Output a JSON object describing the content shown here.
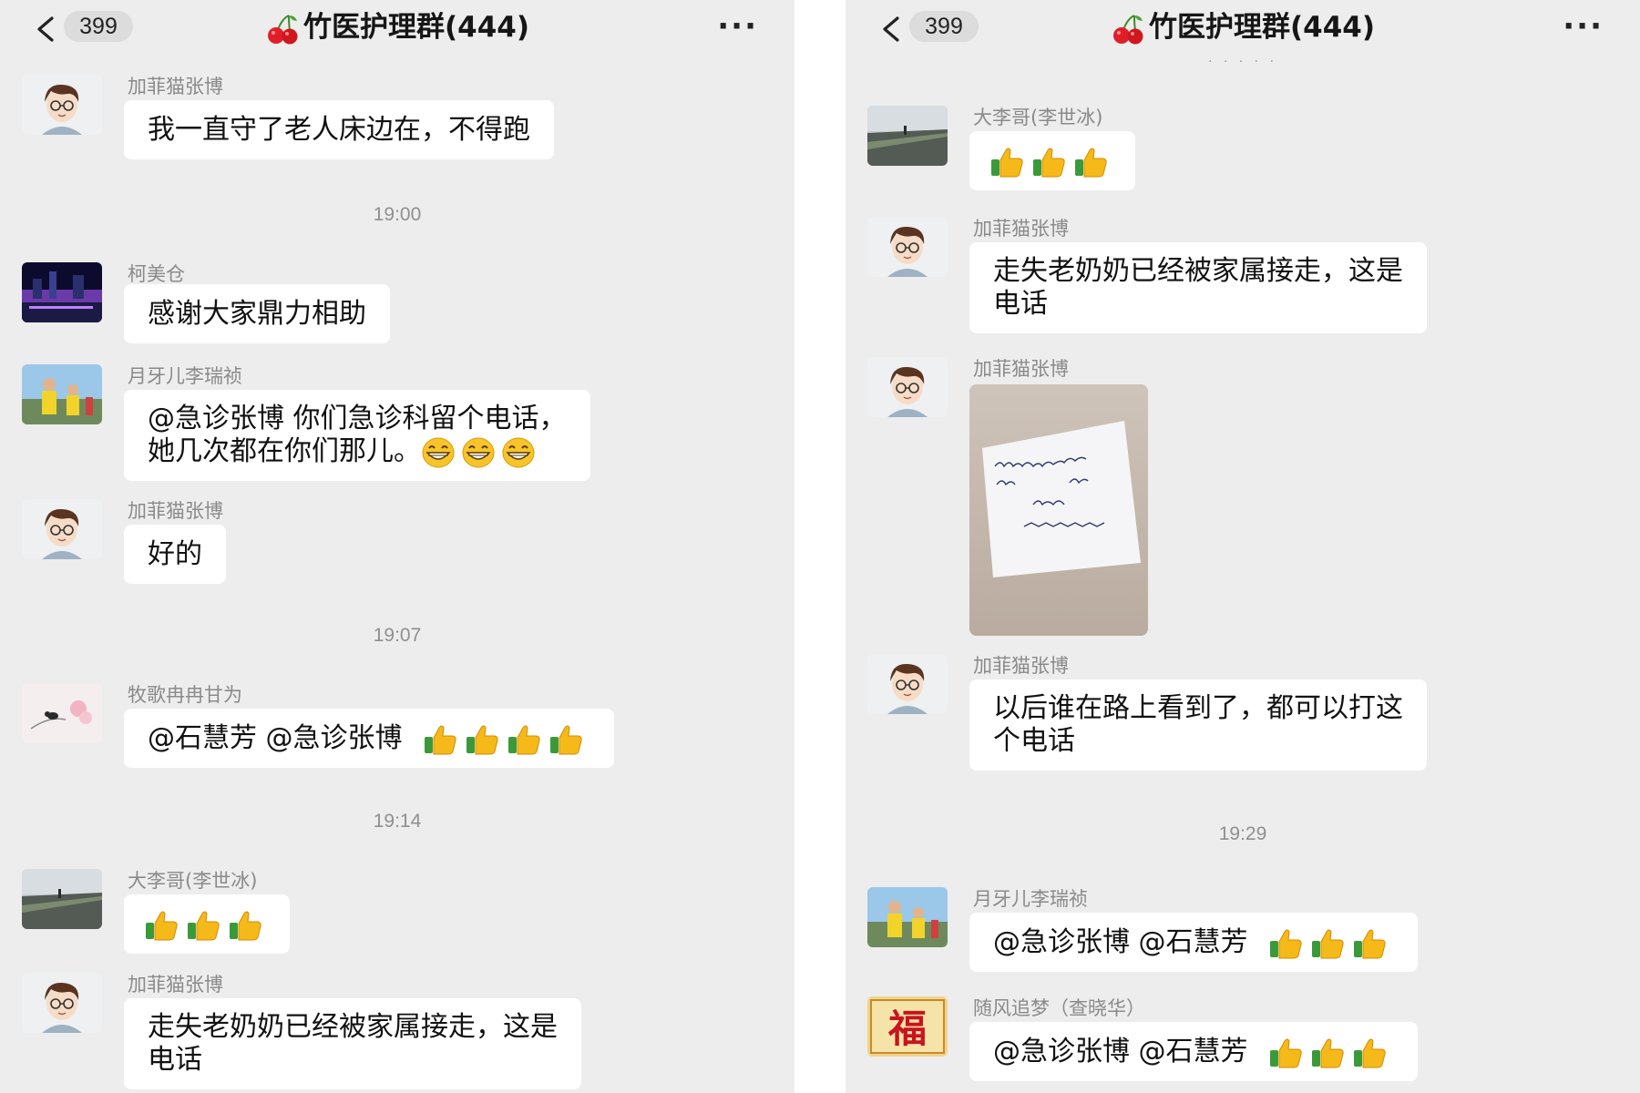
{
  "header": {
    "unread_count": "399",
    "group_title": "竹医护理群(444)",
    "more_label": "···"
  },
  "left_panel": {
    "messages": [
      {
        "sender": "加菲猫张博",
        "text": "我一直守了老人床边在，不得跑"
      },
      {
        "time": "19:00"
      },
      {
        "sender": "柯美仓",
        "text": "感谢大家鼎力相助"
      },
      {
        "sender": "月牙儿李瑞祯",
        "line1": "@急诊张博  你们急诊科留个电话，",
        "line2": "她几次都在你们那儿。"
      },
      {
        "sender": "加菲猫张博",
        "text": "好的"
      },
      {
        "time": "19:07"
      },
      {
        "sender": "牧歌冉冉甘为",
        "text": "@石慧芳  @急诊张博"
      },
      {
        "time": "19:14"
      },
      {
        "sender": "大李哥(李世冰)"
      },
      {
        "sender": "加菲猫张博",
        "line1": "走失老奶奶已经被家属接走，这是",
        "line2": "电话"
      }
    ]
  },
  "right_panel": {
    "top_dots": "· · · · ·",
    "messages": [
      {
        "sender": "大李哥(李世冰)"
      },
      {
        "sender": "加菲猫张博",
        "line1": "走失老奶奶已经被家属接走，这是",
        "line2": "电话"
      },
      {
        "sender": "加菲猫张博",
        "photo": "handwritten-note-photo"
      },
      {
        "sender": "加菲猫张博",
        "line1": "以后谁在路上看到了，都可以打这",
        "line2": "个电话"
      },
      {
        "time": "19:29"
      },
      {
        "sender": "月牙儿李瑞祯",
        "text": "@急诊张博  @石慧芳"
      },
      {
        "sender": "随风追梦（查晓华）",
        "text": "@急诊张博  @石慧芳"
      }
    ]
  },
  "icons": {
    "back": "chevron-left-icon",
    "title_emoji": "cherry-icon",
    "thumbs": "thumbs-up-icon",
    "grin": "grin-emoji-icon"
  },
  "colors": {
    "background": "#ededed",
    "bubble": "#ffffff",
    "nick": "#8a8a8a"
  }
}
